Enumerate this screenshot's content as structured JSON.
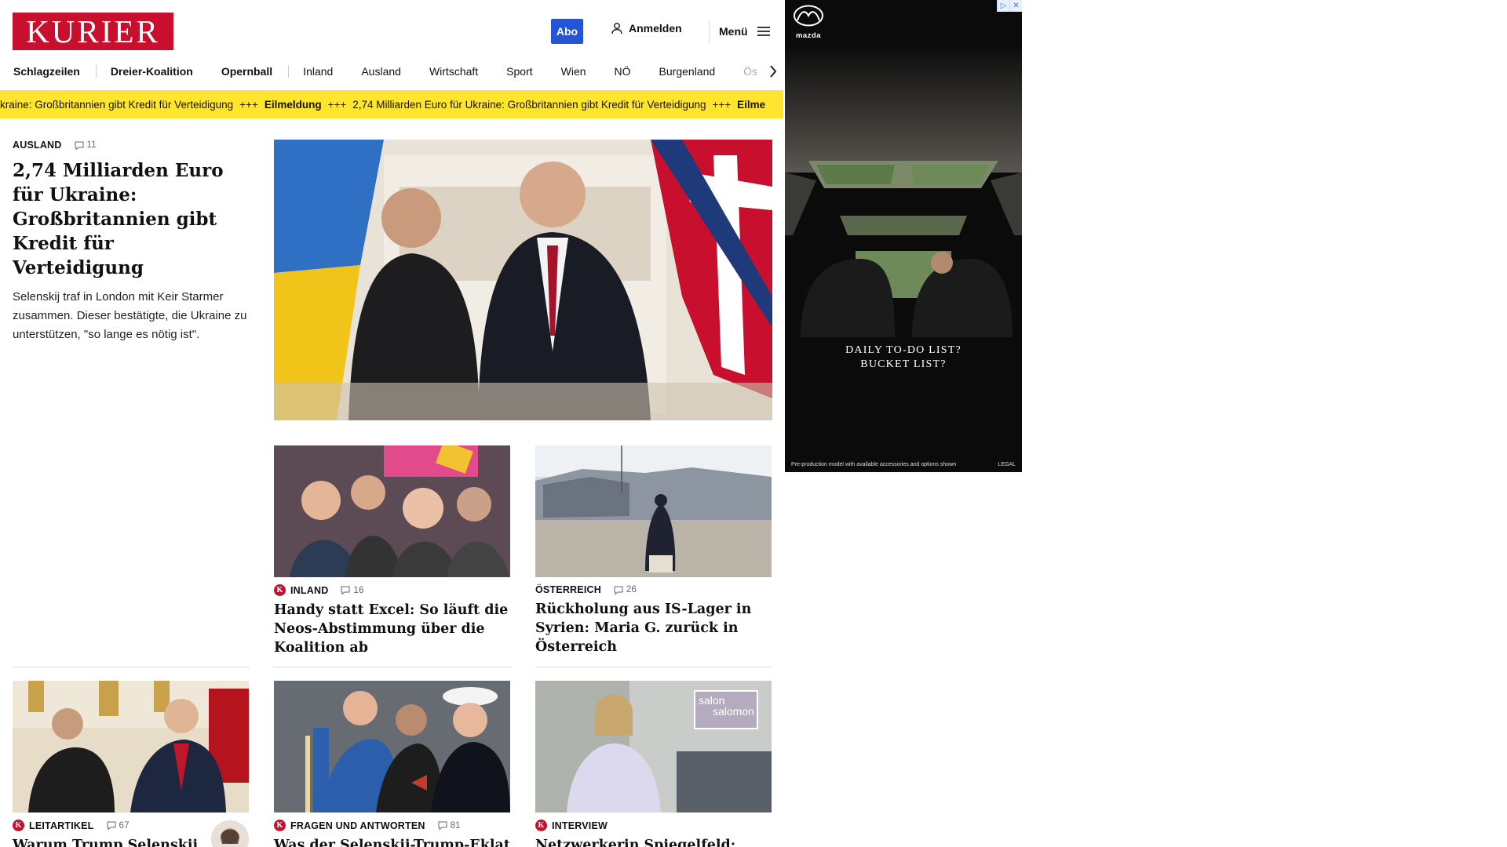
{
  "header": {
    "logo_text": "KURIER",
    "abo_label": "Abo",
    "login_label": "Anmelden",
    "menu_label": "Menü"
  },
  "nav": {
    "items": [
      "Schlagzeilen",
      "Dreier-Koalition",
      "Opernball",
      "Inland",
      "Ausland",
      "Wirtschaft",
      "Sport",
      "Wien",
      "NÖ",
      "Burgenland",
      "Ös"
    ]
  },
  "ticker": {
    "items": [
      "kraine: Großbritannien gibt Kredit für Verteidigung",
      "+++",
      "Eilmeldung",
      "+++",
      "2,74 Milliarden Euro für Ukraine: Großbritannien gibt Kredit für Verteidigung",
      "+++",
      "Eilme"
    ]
  },
  "lead": {
    "section": "AUSLAND",
    "comments": "11",
    "title": "2,74 Milliarden Euro für Ukraine: Großbritannien gibt Kredit für Verteidigung",
    "description": "Selenskij traf in London mit Keir Starmer zusammen. Dieser bestätigte, die Ukraine zu unterstützen, \"so lange es nötig ist\"."
  },
  "cards": [
    {
      "section": "INLAND",
      "comments": "16",
      "title": "Handy statt Excel: So läuft die Neos-Abstimmung über die Koalition ab",
      "badge": "K"
    },
    {
      "section": "ÖSTERREICH",
      "comments": "26",
      "title": "Rückholung aus IS-Lager in Syrien: Maria G. zurück in Österreich"
    },
    {
      "section": "LEITARTIKEL",
      "comments": "67",
      "title": "Warum Trump Selenskij",
      "badge": "K"
    },
    {
      "section": "FRAGEN UND ANTWORTEN",
      "comments": "81",
      "title": "Was der Selenskij-Trump-Eklat",
      "badge": "K"
    },
    {
      "section": "INTERVIEW",
      "title": "Netzwerkerin Spiegelfeld: „Eine",
      "badge": "K"
    }
  ],
  "salon_logo": {
    "line1": "salon",
    "line2": "salomon"
  },
  "ad": {
    "brand": "mazda",
    "tagline_line1": "DAILY TO-DO LIST?",
    "tagline_line2": "BUCKET LIST?",
    "disclaimer": "Pre-production model with available accessories and options shown",
    "legal": "LEGAL"
  },
  "colors": {
    "brand_red": "#c8102e",
    "abo_blue": "#2455d6",
    "ticker_yellow": "#ffe52e"
  }
}
